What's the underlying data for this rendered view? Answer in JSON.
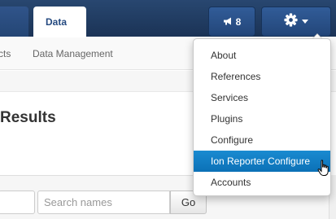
{
  "navbar": {
    "active_tab": "Data",
    "messages": {
      "count": "8",
      "icon": "megaphone-icon"
    },
    "settings": {
      "icon": "gear-icon"
    }
  },
  "subnav": {
    "items": [
      "cts",
      "Data Management"
    ]
  },
  "main": {
    "title": "Results",
    "search": {
      "placeholder": "Search names",
      "go_label": "Go"
    }
  },
  "dropdown": {
    "items": [
      {
        "label": "About",
        "active": false
      },
      {
        "label": "References",
        "active": false
      },
      {
        "label": "Services",
        "active": false
      },
      {
        "label": "Plugins",
        "active": false
      },
      {
        "label": "Configure",
        "active": false
      },
      {
        "label": "Ion Reporter Configure",
        "active": true
      },
      {
        "label": "Accounts",
        "active": false
      }
    ]
  },
  "colors": {
    "navbar": "#1b3356",
    "accent": "#254a80",
    "active_item": "#0e76bc"
  }
}
